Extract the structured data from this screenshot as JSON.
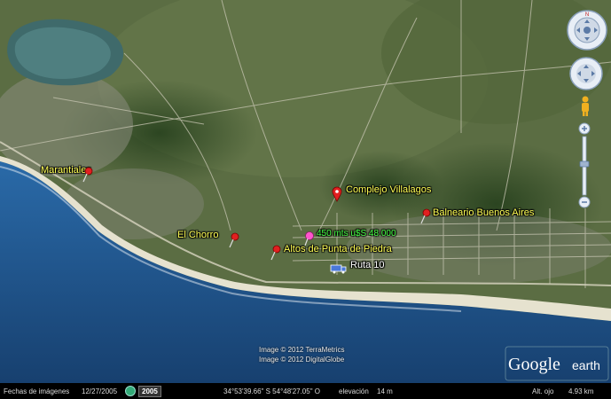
{
  "map": {
    "places": [
      {
        "key": "marantiales",
        "name": "Marantiales"
      },
      {
        "key": "el_chorro",
        "name": "El Chorro"
      },
      {
        "key": "altos",
        "name": "Altos de Punta de Piedra"
      },
      {
        "key": "complejo",
        "name": "Complejo Villalagos"
      },
      {
        "key": "balneario",
        "name": "Balneario Buenos Aires"
      }
    ],
    "note": "450 mts u$S 48.000",
    "route": "Ruta 10",
    "credits": [
      "Image © 2012 TerraMetrics",
      "Image © 2012 DigitalGlobe"
    ]
  },
  "status": {
    "imagery_label": "Fechas de imágenes",
    "imagery_date": "12/27/2005",
    "year_badge": "2005",
    "coords": "34°53'39.66\" S  54°48'27.05\" O",
    "elev_label": "elevación",
    "elev_value": "14 m",
    "eye_label": "Alt. ojo",
    "eye_value": "4.93 km"
  },
  "logo": {
    "google": "Google",
    "earth": "earth"
  },
  "colors": {
    "label": "#ffff55",
    "note": "#44ff44",
    "pin": "#e02020",
    "sea": "#1b4f8a"
  }
}
